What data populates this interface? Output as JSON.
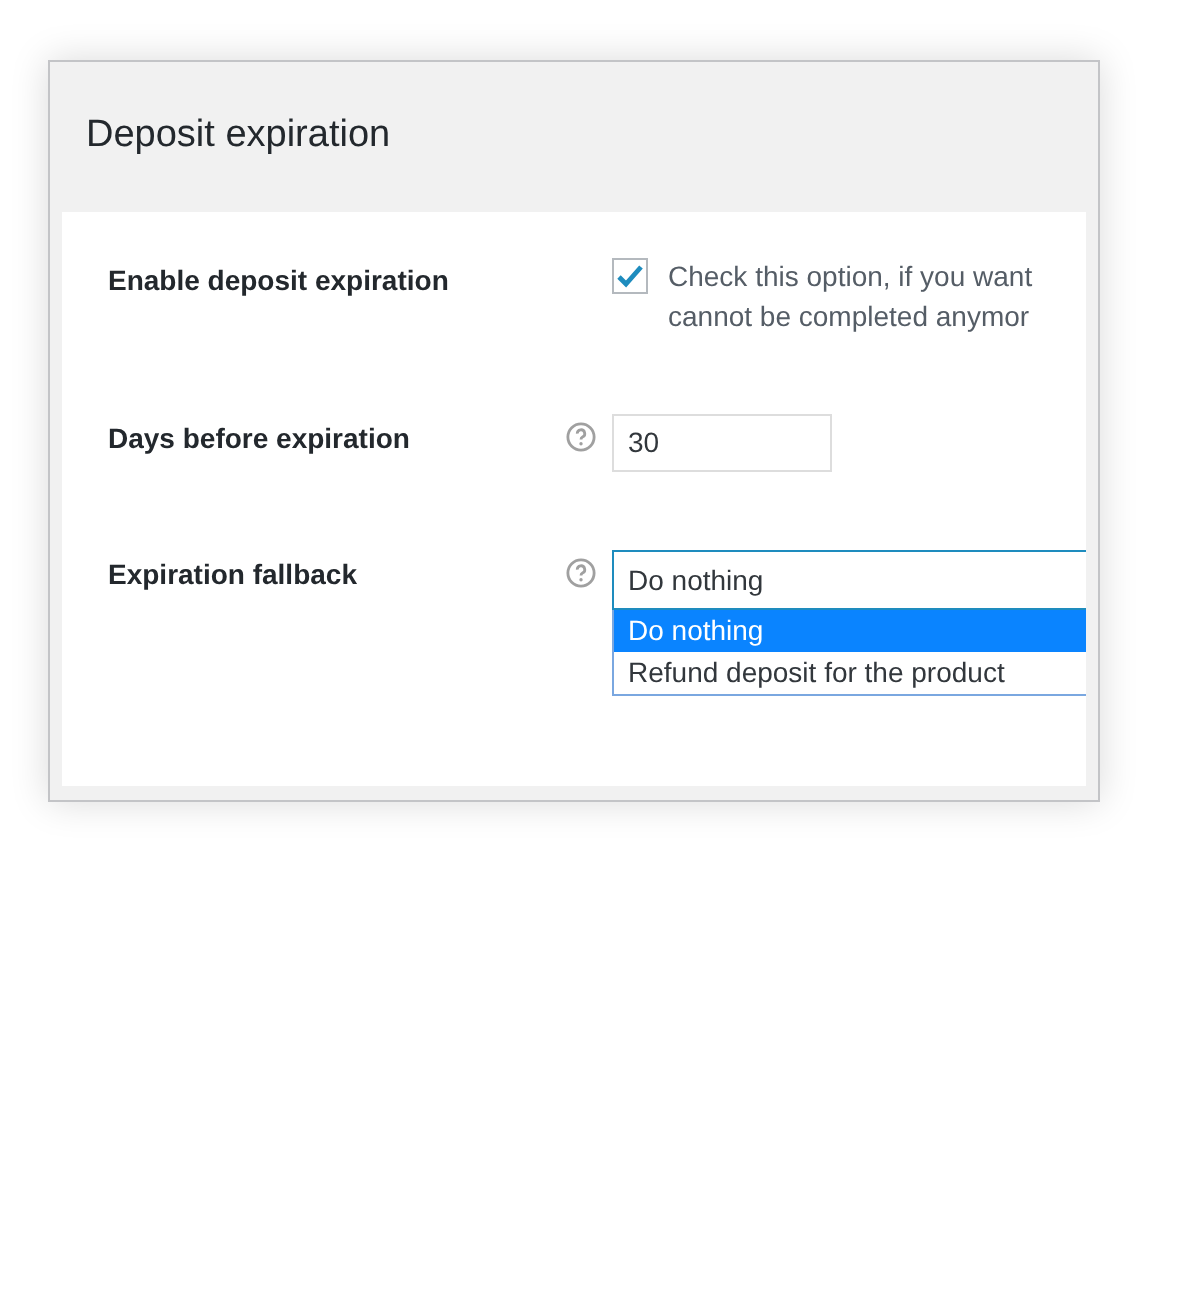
{
  "panel": {
    "title": "Deposit expiration"
  },
  "fields": [
    {
      "kind": "checkbox",
      "label": "Enable deposit expiration",
      "checked": true,
      "description": [
        "Check this option, if you want",
        "cannot be completed anymor"
      ]
    },
    {
      "kind": "number",
      "label": "Days before expiration",
      "help": true,
      "value": "30"
    },
    {
      "kind": "select",
      "label": "Expiration fallback",
      "help": true,
      "value": "Do nothing",
      "expanded": true,
      "options": [
        {
          "label": "Do nothing",
          "selected": true
        },
        {
          "label": "Refund deposit for the product",
          "selected": false
        }
      ]
    }
  ]
}
